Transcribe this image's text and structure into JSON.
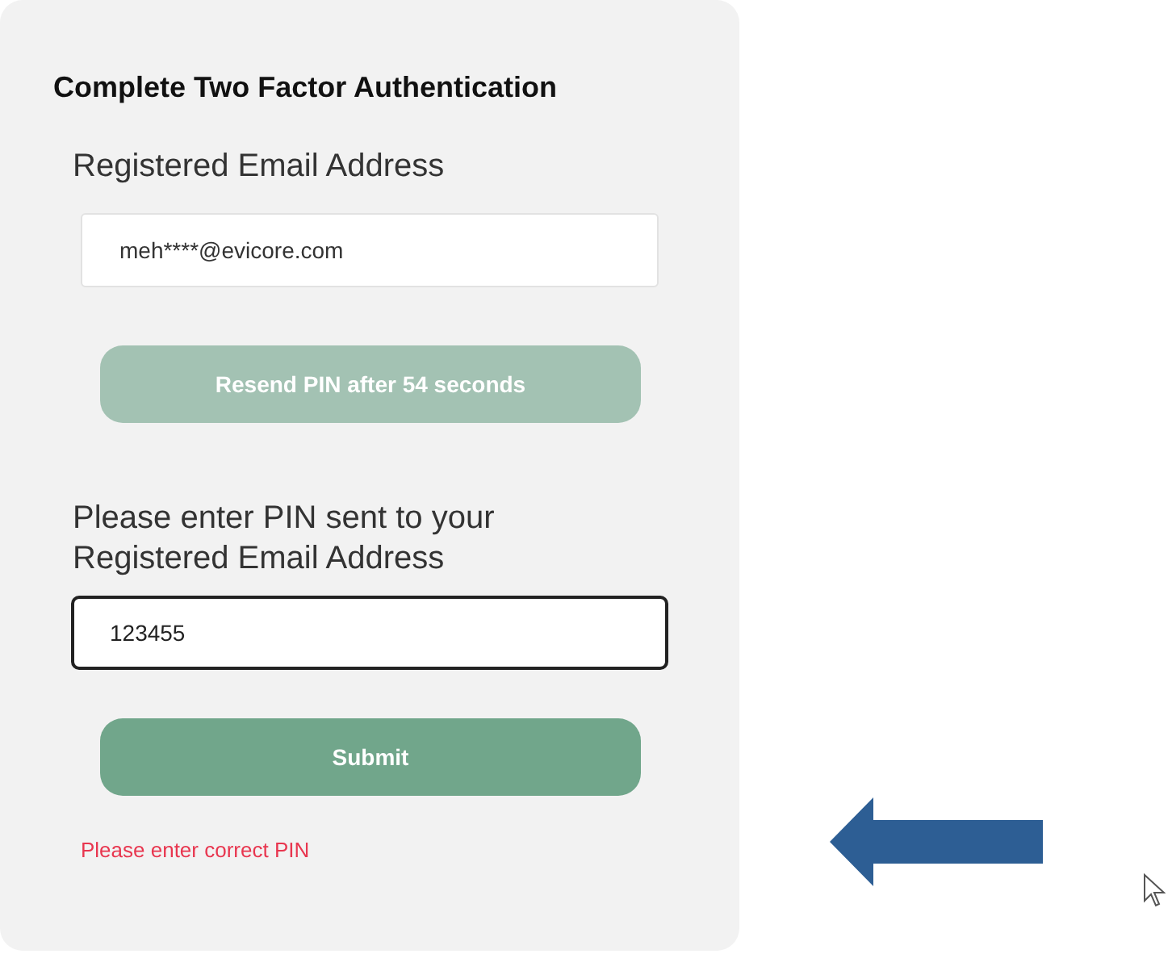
{
  "form": {
    "title": "Complete Two Factor Authentication",
    "email_field": {
      "label": "Registered Email Address",
      "value": "meh****@evicore.com"
    },
    "resend_button": {
      "label": "Resend PIN after 54 seconds",
      "disabled": true
    },
    "pin_field": {
      "label": "Please enter PIN sent to your Registered Email Address",
      "value": "123455"
    },
    "submit_button": {
      "label": "Submit",
      "disabled": false
    },
    "error_message": "Please enter correct PIN"
  }
}
